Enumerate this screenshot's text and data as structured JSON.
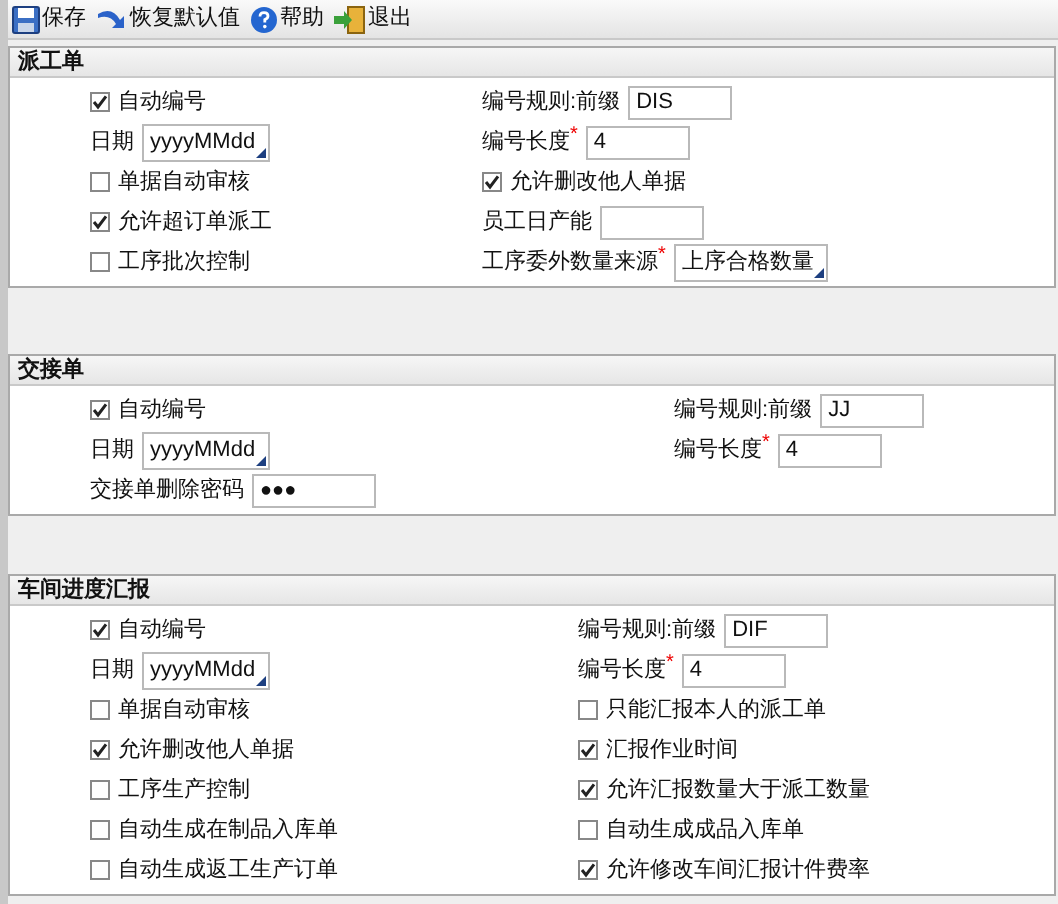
{
  "toolbar": [
    {
      "label": "保存"
    },
    {
      "label": "恢复默认值"
    },
    {
      "label": "帮助"
    },
    {
      "label": "退出"
    }
  ],
  "sections": [
    {
      "title": "派工单",
      "rows": [
        [
          {
            "kind": "checkbox",
            "label": "自动编号",
            "checked": true
          },
          {
            "kind": "field",
            "label": "编号规则:前缀",
            "value": "DIS"
          }
        ],
        [
          {
            "kind": "dropdown",
            "label": "日期",
            "value": "yyyyMMdd"
          },
          {
            "kind": "field",
            "label": "编号长度",
            "required_mark": "*",
            "value": "4"
          }
        ],
        [
          {
            "kind": "checkbox",
            "label": "单据自动审核",
            "checked": false
          },
          {
            "kind": "checkbox",
            "label": "允许删改他人单据",
            "checked": true
          }
        ],
        [
          {
            "kind": "checkbox",
            "label": "允许超订单派工",
            "checked": true
          },
          {
            "kind": "field",
            "label": "员工日产能"
          }
        ],
        [
          {
            "kind": "checkbox",
            "label": "工序批次控制",
            "checked": false
          },
          {
            "kind": "dropdown",
            "label": "工序委外数量来源",
            "required_mark": "*",
            "value": "上序合格数量"
          }
        ]
      ]
    },
    {
      "title": "交接单",
      "rows": [
        [
          {
            "kind": "checkbox",
            "label": "自动编号",
            "checked": true
          },
          {
            "kind": "field",
            "label": "编号规则:前缀",
            "value": "JJ"
          }
        ],
        [
          {
            "kind": "dropdown",
            "label": "日期",
            "value": "yyyyMMdd"
          },
          {
            "kind": "field",
            "label": "编号长度",
            "required_mark": "*",
            "value": "4"
          }
        ],
        [
          {
            "kind": "password",
            "label": "交接单删除密码",
            "value": "●●●"
          }
        ]
      ]
    },
    {
      "title": "车间进度汇报",
      "rows": [
        [
          {
            "kind": "checkbox",
            "label": "自动编号",
            "checked": true
          },
          {
            "kind": "field",
            "label": "编号规则:前缀",
            "value": "DIF"
          }
        ],
        [
          {
            "kind": "dropdown",
            "label": "日期",
            "value": "yyyyMMdd"
          },
          {
            "kind": "field",
            "label": "编号长度",
            "required_mark": "*",
            "value": "4"
          }
        ],
        [
          {
            "kind": "checkbox",
            "label": "单据自动审核",
            "checked": false
          },
          {
            "kind": "checkbox",
            "label": "只能汇报本人的派工单",
            "checked": false
          }
        ],
        [
          {
            "kind": "checkbox",
            "label": "允许删改他人单据",
            "checked": true
          },
          {
            "kind": "checkbox",
            "label": "汇报作业时间",
            "checked": true
          }
        ],
        [
          {
            "kind": "checkbox",
            "label": "工序生产控制",
            "checked": false
          },
          {
            "kind": "checkbox",
            "label": "允许汇报数量大于派工数量",
            "checked": true
          }
        ],
        [
          {
            "kind": "checkbox",
            "label": "自动生成在制品入库单",
            "checked": false
          },
          {
            "kind": "checkbox",
            "label": "自动生成成品入库单",
            "checked": false
          }
        ],
        [
          {
            "kind": "checkbox",
            "label": "自动生成返工生产订单",
            "checked": false
          },
          {
            "kind": "checkbox",
            "label": "允许修改车间汇报计件费率",
            "checked": true
          }
        ]
      ]
    }
  ]
}
